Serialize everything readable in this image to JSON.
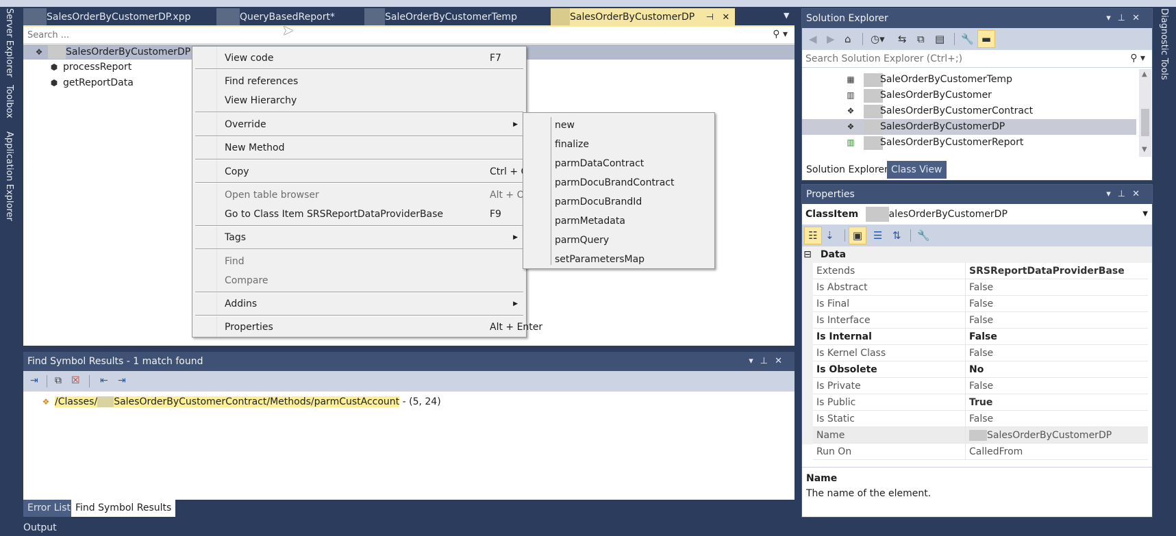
{
  "side_tabs_left": [
    "Server Explorer",
    "Toolbox",
    "Application Explorer"
  ],
  "side_tabs_right": [
    "Diagnostic Tools"
  ],
  "document_tabs": [
    {
      "label": "SalesOrderByCustomerDP.xpp",
      "active": false
    },
    {
      "label": "QueryBasedReport*",
      "active": false
    },
    {
      "label": "SaleOrderByCustomerTemp",
      "active": false
    },
    {
      "label": "SalesOrderByCustomerDP",
      "active": true
    }
  ],
  "editor": {
    "search_placeholder": "Search ...",
    "tree": {
      "root": "SalesOrderByCustomerDP",
      "children": [
        "processReport",
        "getReportData"
      ]
    }
  },
  "context_menu": {
    "items": [
      {
        "label": "View code",
        "shortcut": "F7",
        "disabled": false
      },
      {
        "label": "Find references",
        "shortcut": "",
        "disabled": false
      },
      {
        "label": "View Hierarchy",
        "shortcut": "",
        "disabled": false
      },
      {
        "label": "Override",
        "shortcut": "",
        "submenu": true,
        "disabled": false
      },
      {
        "label": "New Method",
        "shortcut": "",
        "disabled": false
      },
      {
        "label": "Copy",
        "shortcut": "Ctrl + C",
        "disabled": false
      },
      {
        "label": "Open table browser",
        "shortcut": "Alt + O",
        "disabled": true
      },
      {
        "label": "Go to Class Item SRSReportDataProviderBase",
        "shortcut": "F9",
        "disabled": false
      },
      {
        "label": "Tags",
        "shortcut": "",
        "submenu": true,
        "disabled": false
      },
      {
        "label": "Find",
        "shortcut": "",
        "disabled": true
      },
      {
        "label": "Compare",
        "shortcut": "",
        "disabled": true
      },
      {
        "label": "Addins",
        "shortcut": "",
        "submenu": true,
        "disabled": false
      },
      {
        "label": "Properties",
        "shortcut": "Alt + Enter",
        "disabled": false
      }
    ]
  },
  "override_submenu": {
    "items": [
      "new",
      "finalize",
      "parmDataContract",
      "parmDocuBrandContract",
      "parmDocuBrandId",
      "parmMetadata",
      "parmQuery",
      "setParametersMap"
    ]
  },
  "find_symbol_results": {
    "title": "Find Symbol Results - 1 match found",
    "result_path_prefix": "/Classes/",
    "result_path_suffix": "SalesOrderByCustomerContract/Methods/parmCustAccount",
    "result_location": " - (5, 24)"
  },
  "bottom_tabs": [
    {
      "label": "Error List",
      "active": false
    },
    {
      "label": "Find Symbol Results",
      "active": true
    }
  ],
  "output_label": "Output",
  "solution_explorer": {
    "title": "Solution Explorer",
    "search_placeholder": "Search Solution Explorer (Ctrl+;)",
    "items": [
      {
        "label": "SaleOrderByCustomerTemp",
        "icon": "table-icon",
        "selected": false
      },
      {
        "label": "SalesOrderByCustomer",
        "icon": "report-icon",
        "selected": false
      },
      {
        "label": "SalesOrderByCustomerContract",
        "icon": "class-icon",
        "selected": false
      },
      {
        "label": "SalesOrderByCustomerDP",
        "icon": "class-icon",
        "selected": true
      },
      {
        "label": "SalesOrderByCustomerReport",
        "icon": "report-run-icon",
        "selected": false
      }
    ],
    "tabs": [
      {
        "label": "Solution Explorer",
        "active": true
      },
      {
        "label": "Class View",
        "active": false
      }
    ]
  },
  "properties": {
    "title": "Properties",
    "object_type": "ClassItem",
    "object_name": "alesOrderByCustomerDP",
    "category": "Data",
    "rows": [
      {
        "key": "Extends",
        "value": "SRSReportDataProviderBase",
        "bold_value": true
      },
      {
        "key": "Is Abstract",
        "value": "False"
      },
      {
        "key": "Is Final",
        "value": "False"
      },
      {
        "key": "Is Interface",
        "value": "False"
      },
      {
        "key": "Is Internal",
        "value": "False",
        "bold": true
      },
      {
        "key": "Is Kernel Class",
        "value": "False"
      },
      {
        "key": "Is Obsolete",
        "value": "No",
        "bold": true
      },
      {
        "key": "Is Private",
        "value": "False"
      },
      {
        "key": "Is Public",
        "value": "True",
        "bold_value": true
      },
      {
        "key": "Is Static",
        "value": "False"
      },
      {
        "key": "Name",
        "value": "SalesOrderByCustomerDP",
        "selected": true
      },
      {
        "key": "Run On",
        "value": "CalledFrom"
      }
    ],
    "description_title": "Name",
    "description_text": "The name of the element."
  },
  "colors": {
    "frame": "#2b3c5c",
    "active_tab": "#f5e7a3",
    "panel_title": "#3f5276",
    "toolbar": "#ccd4e4",
    "highlight": "#fbf097"
  }
}
